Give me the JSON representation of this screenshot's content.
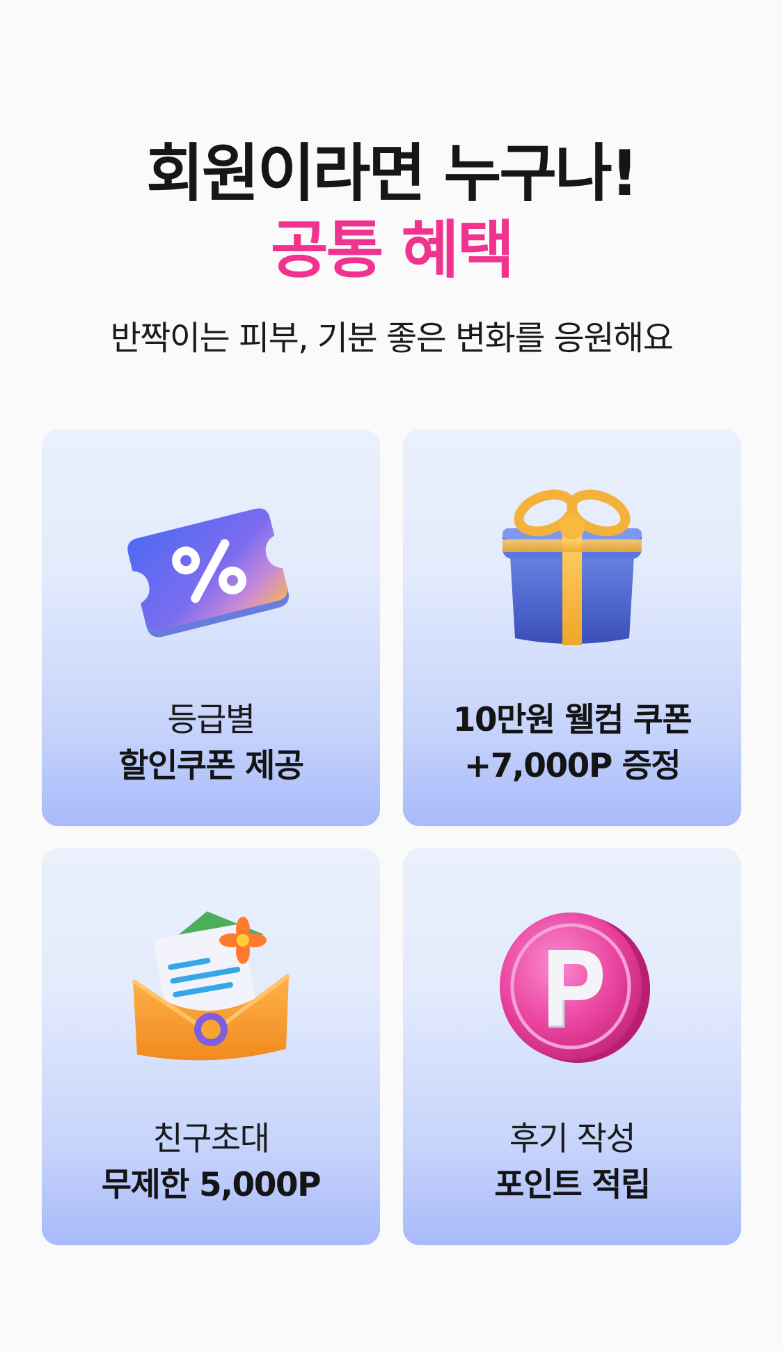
{
  "header": {
    "title_line1": "회원이라면 누구나!",
    "title_line2": "공통 혜택",
    "subtitle": "반짝이는 피부, 기분 좋은 변화를 응원해요",
    "accent_color": "#f0338f"
  },
  "benefits": [
    {
      "icon": "discount-ticket-icon",
      "line1": "등급별",
      "line2": "할인쿠폰 제공",
      "line1_bold": false
    },
    {
      "icon": "gift-box-icon",
      "line1": "10만원 웰컴 쿠폰",
      "line2": "+7,000P 증정",
      "line1_bold": true
    },
    {
      "icon": "invitation-envelope-icon",
      "line1": "친구초대",
      "line2": "무제한 5,000P",
      "line1_bold": false
    },
    {
      "icon": "point-coin-icon",
      "line1": "후기 작성",
      "line2": "포인트 적립",
      "line1_bold": false
    }
  ]
}
